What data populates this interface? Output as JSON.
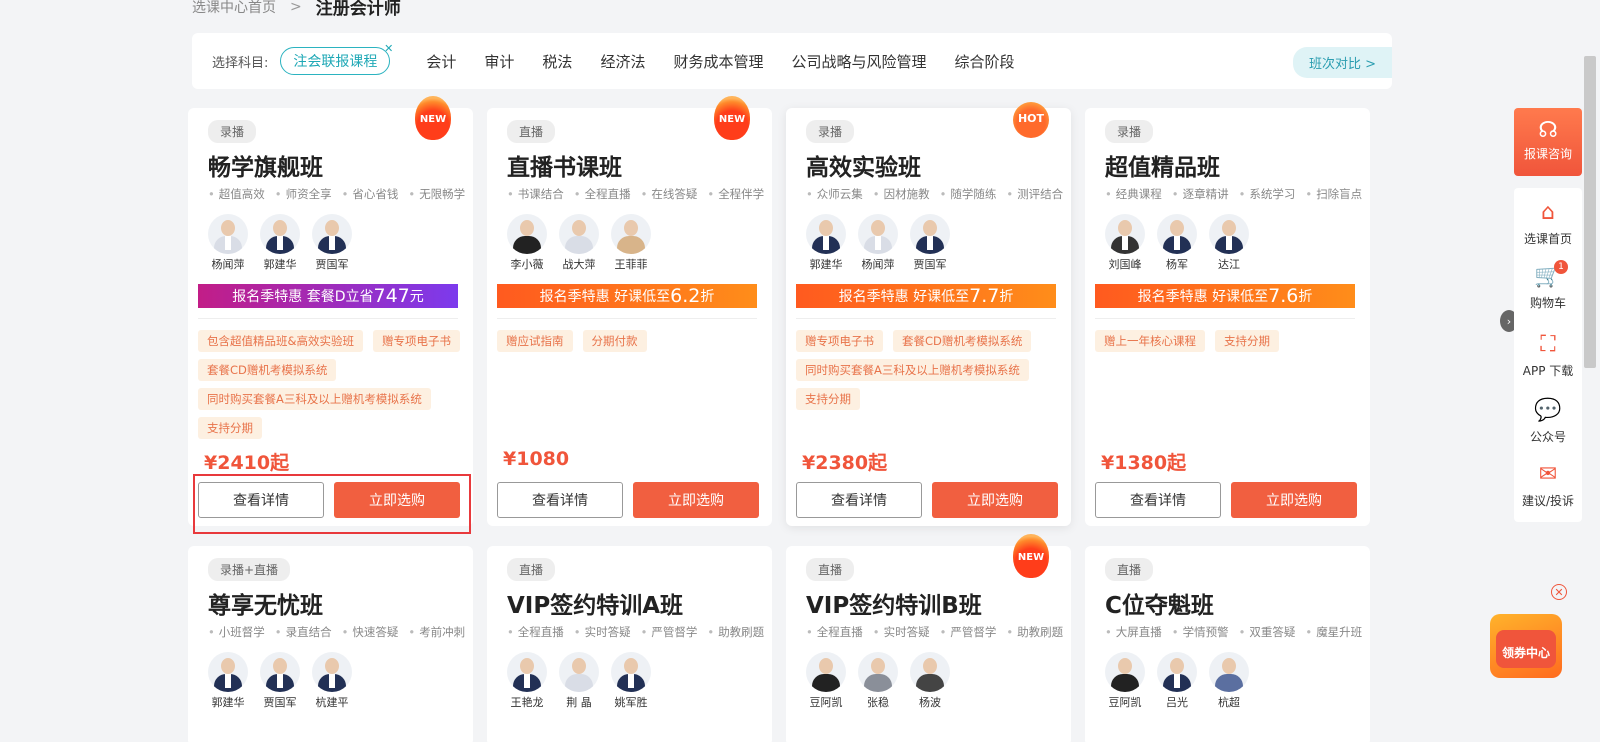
{
  "breadcrumb": {
    "home": "选课中心首页",
    "sep": ">",
    "current": "注册会计师"
  },
  "filter": {
    "label": "选择科目:",
    "selected": "注会联报课程",
    "clear_icon": "close-icon",
    "subjects": [
      "会计",
      "审计",
      "税法",
      "经济法",
      "财务成本管理",
      "公司战略与风险管理",
      "综合阶段"
    ],
    "compare": "班次对比 >"
  },
  "cards": [
    {
      "tag": "录播",
      "badge": "NEW",
      "title": "畅学旗舰班",
      "features": [
        "超值高效",
        "师资全享",
        "省心省钱",
        "无限畅学"
      ],
      "teachers": [
        "杨闻萍",
        "郭建华",
        "贾国军"
      ],
      "promo": {
        "prefix": "报名季特惠  套餐D立省",
        "value": "747",
        "suffix": "元",
        "style": "purple"
      },
      "gifts": [
        "包含超值精品班&高效实验班",
        "赠专项电子书",
        "套餐CD赠机考模拟系统",
        "同时购买套餐A三科及以上赠机考模拟系统",
        "支持分期"
      ],
      "price": "¥2410起",
      "detail": "查看详情",
      "buy": "立即选购"
    },
    {
      "tag": "直播",
      "badge": "NEW",
      "title": "直播书课班",
      "features": [
        "书课结合",
        "全程直播",
        "在线答疑",
        "全程伴学"
      ],
      "teachers": [
        "李小薇",
        "战大萍",
        "王菲菲"
      ],
      "promo": {
        "prefix": "报名季特惠  好课低至",
        "value": "6.2",
        "suffix": "折",
        "style": "orange"
      },
      "gifts": [
        "赠应试指南",
        "分期付款"
      ],
      "price": "¥1080",
      "detail": "查看详情",
      "buy": "立即选购"
    },
    {
      "tag": "录播",
      "badge": "HOT",
      "title": "高效实验班",
      "features": [
        "众师云集",
        "因材施教",
        "随学随练",
        "测评结合"
      ],
      "teachers": [
        "郭建华",
        "杨闻萍",
        "贾国军"
      ],
      "promo": {
        "prefix": "报名季特惠  好课低至",
        "value": "7.7",
        "suffix": "折",
        "style": "orange"
      },
      "gifts": [
        "赠专项电子书",
        "套餐CD赠机考模拟系统",
        "同时购买套餐A三科及以上赠机考模拟系统",
        "支持分期"
      ],
      "price": "¥2380起",
      "detail": "查看详情",
      "buy": "立即选购"
    },
    {
      "tag": "录播",
      "badge": "",
      "title": "超值精品班",
      "features": [
        "经典课程",
        "逐章精讲",
        "系统学习",
        "扫除盲点"
      ],
      "teachers": [
        "刘国峰",
        "杨军",
        "达江"
      ],
      "promo": {
        "prefix": "报名季特惠  好课低至",
        "value": "7.6",
        "suffix": "折",
        "style": "orange"
      },
      "gifts": [
        "赠上一年核心课程",
        "支持分期"
      ],
      "price": "¥1380起",
      "detail": "查看详情",
      "buy": "立即选购"
    },
    {
      "tag": "录播+直播",
      "badge": "",
      "title": "尊享无忧班",
      "features": [
        "小班督学",
        "录直结合",
        "快速答疑",
        "考前冲刺"
      ],
      "teachers": [
        "郭建华",
        "贾国军",
        "杭建平"
      ]
    },
    {
      "tag": "直播",
      "badge": "",
      "title": "VIP签约特训A班",
      "features": [
        "全程直播",
        "实时答疑",
        "严管督学",
        "助教刷题"
      ],
      "teachers": [
        "王艳龙",
        "荆  晶",
        "姚军胜"
      ]
    },
    {
      "tag": "直播",
      "badge": "NEW",
      "title": "VIP签约特训B班",
      "features": [
        "全程直播",
        "实时答疑",
        "严管督学",
        "助教刷题"
      ],
      "teachers": [
        "豆阿凯",
        "张稳",
        "杨波"
      ]
    },
    {
      "tag": "直播",
      "badge": "",
      "title": "C位夺魁班",
      "features": [
        "大屏直播",
        "学情预警",
        "双重答疑",
        "魔星升班"
      ],
      "teachers": [
        "豆阿凯",
        "吕光",
        "杭超"
      ]
    }
  ],
  "sidebar": {
    "consult": "报课咨询",
    "items": [
      {
        "label": "选课首页",
        "icon": "home-icon"
      },
      {
        "label": "购物车",
        "icon": "cart-icon",
        "count": "1"
      },
      {
        "label": "APP 下载",
        "icon": "scan-icon"
      },
      {
        "label": "公众号",
        "icon": "wechat-icon"
      },
      {
        "label": "建议/投诉",
        "icon": "mail-icon"
      }
    ]
  },
  "coupon": {
    "label": "领券中心",
    "icon": "coupon-bag-icon"
  }
}
